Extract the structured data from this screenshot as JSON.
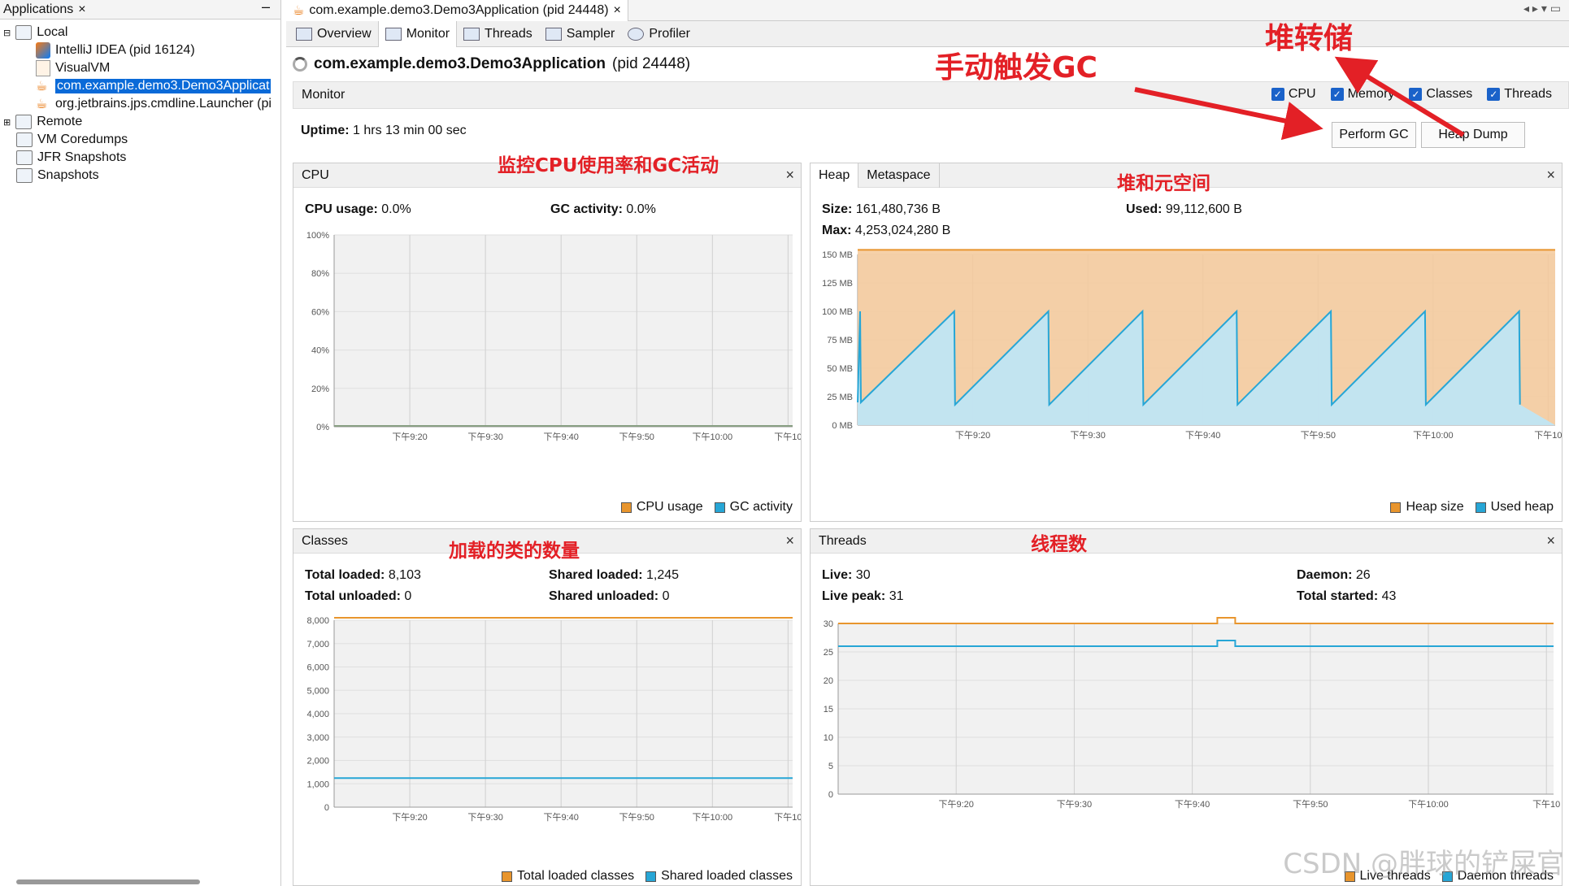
{
  "left": {
    "tab_label": "Applications",
    "tree": [
      {
        "label": "Local"
      },
      {
        "label": "IntelliJ IDEA (pid 16124)"
      },
      {
        "label": "VisualVM"
      },
      {
        "label": "com.example.demo3.Demo3Applicat"
      },
      {
        "label": "org.jetbrains.jps.cmdline.Launcher (pi"
      },
      {
        "label": "Remote"
      },
      {
        "label": "VM Coredumps"
      },
      {
        "label": "JFR Snapshots"
      },
      {
        "label": "Snapshots"
      }
    ]
  },
  "doc_tab": "com.example.demo3.Demo3Application (pid 24448)",
  "subtabs": [
    "Overview",
    "Monitor",
    "Threads",
    "Sampler",
    "Profiler"
  ],
  "app_title": "com.example.demo3.Demo3Application",
  "app_pid": "(pid 24448)",
  "monitor_label": "Monitor",
  "checkboxes": [
    "CPU",
    "Memory",
    "Classes",
    "Threads"
  ],
  "uptime_label": "Uptime:",
  "uptime_value": "1 hrs 13 min 00 sec",
  "perform_gc": "Perform GC",
  "heap_dump": "Heap Dump",
  "x_ticks": [
    "下午9:20",
    "下午9:30",
    "下午9:40",
    "下午9:50",
    "下午10:00",
    "下午10"
  ],
  "cpu": {
    "title": "CPU",
    "usage_label": "CPU usage:",
    "usage_value": "0.0%",
    "gc_label": "GC activity:",
    "gc_value": "0.0%",
    "y_ticks": [
      "100%",
      "80%",
      "60%",
      "40%",
      "20%",
      "0%"
    ],
    "legend": [
      "CPU usage",
      "GC activity"
    ]
  },
  "heap": {
    "tab_heap": "Heap",
    "tab_meta": "Metaspace",
    "size_label": "Size:",
    "size_value": "161,480,736 B",
    "used_label": "Used:",
    "used_value": "99,112,600 B",
    "max_label": "Max:",
    "max_value": "4,253,024,280 B",
    "y_ticks": [
      "150 MB",
      "125 MB",
      "100 MB",
      "75 MB",
      "50 MB",
      "25 MB",
      "0 MB"
    ],
    "legend": [
      "Heap size",
      "Used heap"
    ]
  },
  "classes": {
    "title": "Classes",
    "total_loaded_label": "Total loaded:",
    "total_loaded_value": "8,103",
    "shared_loaded_label": "Shared loaded:",
    "shared_loaded_value": "1,245",
    "total_unloaded_label": "Total unloaded:",
    "total_unloaded_value": "0",
    "shared_unloaded_label": "Shared unloaded:",
    "shared_unloaded_value": "0",
    "y_ticks": [
      "8,000",
      "7,000",
      "6,000",
      "5,000",
      "4,000",
      "3,000",
      "2,000",
      "1,000",
      "0"
    ],
    "legend": [
      "Total loaded classes",
      "Shared loaded classes"
    ]
  },
  "threads": {
    "title": "Threads",
    "live_label": "Live:",
    "live_value": "30",
    "daemon_label": "Daemon:",
    "daemon_value": "26",
    "peak_label": "Live peak:",
    "peak_value": "31",
    "started_label": "Total started:",
    "started_value": "43",
    "y_ticks": [
      "30",
      "25",
      "20",
      "15",
      "10",
      "5",
      "0"
    ],
    "x_ticks": [
      "下午9:20",
      "下午9:30",
      "下午9:40",
      "下午9:50",
      "下午10:00",
      "下午10"
    ],
    "legend": [
      "Live threads",
      "Daemon threads"
    ]
  },
  "annotations": {
    "gc": "手动触发GC",
    "dump": "堆转储",
    "cpu": "监控CPU使用率和GC活动",
    "heap": "堆和元空间",
    "classes": "加载的类的数量",
    "threads": "线程数"
  },
  "watermark": "CSDN @胖球的铲屎官",
  "colors": {
    "orange": "#e8952d",
    "blue": "#27a6d6",
    "selection": "#0a6ad8",
    "annotation": "#e32026"
  }
}
